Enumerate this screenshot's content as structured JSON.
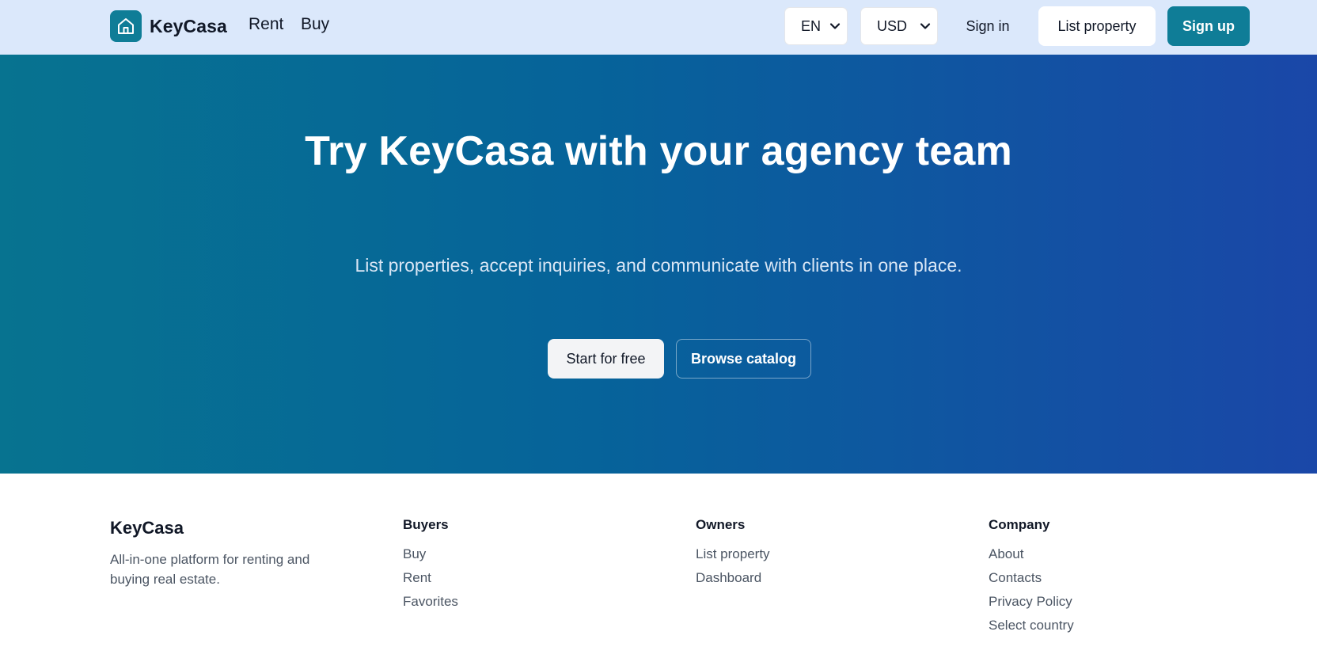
{
  "header": {
    "brand": "KeyCasa",
    "nav": {
      "rent": "Rent",
      "buy": "Buy"
    },
    "language": "EN",
    "currency": "USD",
    "sign_in": "Sign in",
    "list_property": "List property",
    "sign_up": "Sign up"
  },
  "hero": {
    "title": "Try KeyCasa with your agency team",
    "subtitle": "List properties, accept inquiries, and communicate with clients in one place.",
    "start_button": "Start for free",
    "browse_button": "Browse catalog"
  },
  "footer": {
    "brand": "KeyCasa",
    "description": "All-in-one platform for renting and buying real estate.",
    "buyers": {
      "heading": "Buyers",
      "links": [
        "Buy",
        "Rent",
        "Favorites"
      ]
    },
    "owners": {
      "heading": "Owners",
      "links": [
        "List property",
        "Dashboard"
      ]
    },
    "company": {
      "heading": "Company",
      "links": [
        "About",
        "Contacts",
        "Privacy Policy",
        "Select country"
      ]
    }
  },
  "colors": {
    "accent": "#0f7d97",
    "header_bg": "#dbe8fb",
    "hero_gradient_start": "#077390",
    "hero_gradient_end": "#1a47a8"
  },
  "icons": {
    "logo": "house-icon",
    "select": "chevron-down-icon"
  }
}
